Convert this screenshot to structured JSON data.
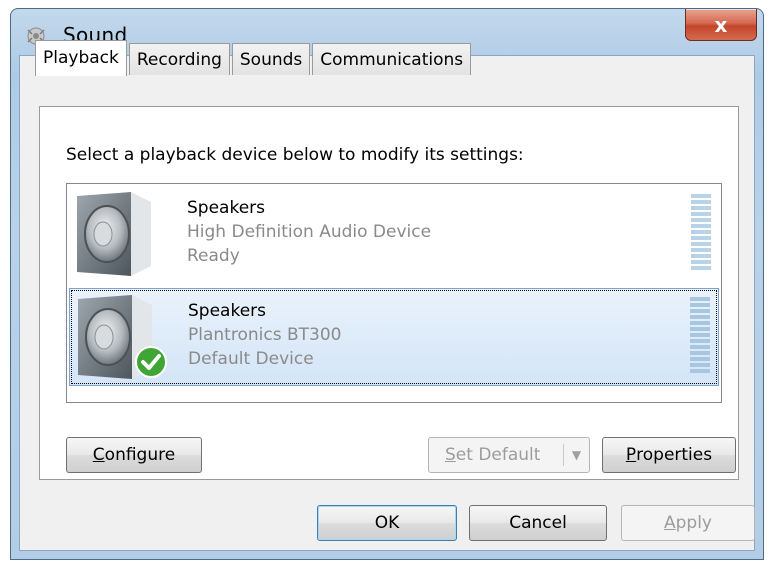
{
  "window": {
    "title": "Sound",
    "close_label": "x"
  },
  "tabs": [
    {
      "label": "Playback",
      "active": true
    },
    {
      "label": "Recording",
      "active": false
    },
    {
      "label": "Sounds",
      "active": false
    },
    {
      "label": "Communications",
      "active": false
    }
  ],
  "panel": {
    "instruction": "Select a playback device below to modify its settings:",
    "devices": [
      {
        "name": "Speakers",
        "description": "High Definition Audio Device",
        "status": "Ready",
        "selected": false,
        "is_default": false,
        "icon": "speaker-icon"
      },
      {
        "name": "Speakers",
        "description": "Plantronics BT300",
        "status": "Default Device",
        "selected": true,
        "is_default": true,
        "icon": "speaker-icon"
      }
    ],
    "configure_label": "Configure",
    "configure_accel": "C",
    "configure_rest": "onfigure",
    "set_default_accel": "S",
    "set_default_rest": "et Default",
    "properties_accel": "P",
    "properties_rest": "roperties"
  },
  "footer": {
    "ok_label": "OK",
    "cancel_label": "Cancel",
    "apply_accel": "A",
    "apply_rest": "pply"
  },
  "colors": {
    "selection_bg": "#d3e5f7",
    "check_green": "#3fa535",
    "level_meter": "#b8d3e8"
  }
}
